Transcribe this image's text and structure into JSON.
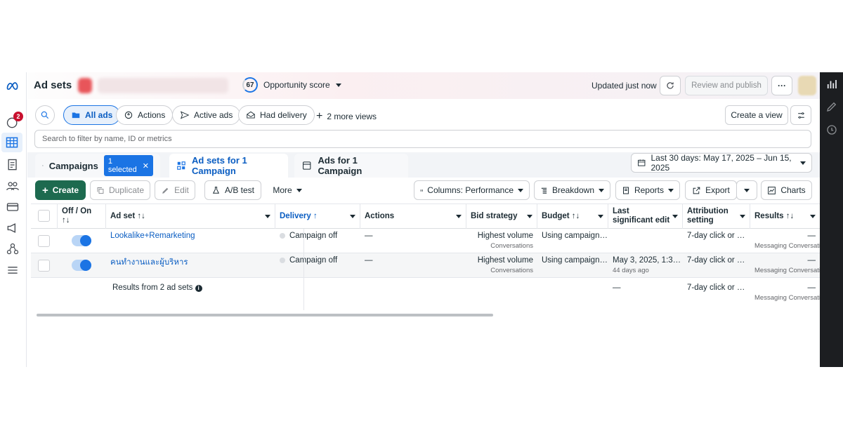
{
  "nav": {
    "notifications_count": "2",
    "items": [
      "meta-logo-icon",
      "notifications-icon",
      "campaigns-table-icon",
      "pages-icon",
      "audiences-icon",
      "billing-icon",
      "ads-manager-icon",
      "business-icon",
      "menu-icon"
    ]
  },
  "header": {
    "title": "Ad sets",
    "opportunity_score": "67",
    "opportunity_label": "Opportunity score",
    "updated": "Updated just now",
    "review_publish": "Review and publish",
    "more": "···"
  },
  "views": {
    "all_ads": "All ads",
    "actions": "Actions",
    "active_ads": "Active ads",
    "had_delivery": "Had delivery",
    "more_views": "2 more views",
    "create_view": "Create a view"
  },
  "search": {
    "placeholder": "Search to filter by name, ID or metrics"
  },
  "tabs": {
    "campaigns": "Campaigns",
    "selected": "1 selected",
    "adsets": "Ad sets for 1 Campaign",
    "ads": "Ads for 1 Campaign"
  },
  "date_range": "Last 30 days: May 17, 2025 – Jun 15, 2025",
  "toolbar": {
    "create": "Create",
    "duplicate": "Duplicate",
    "edit": "Edit",
    "ab_test": "A/B test",
    "more": "More",
    "columns": "Columns: Performance",
    "breakdown": "Breakdown",
    "reports": "Reports",
    "export": "Export",
    "charts": "Charts"
  },
  "table": {
    "headers": {
      "offon": "Off / On",
      "offon_sort": "↑↓",
      "adset": "Ad set ↑↓",
      "delivery": "Delivery ↑",
      "actions": "Actions",
      "bid": "Bid strategy",
      "budget": "Budget ↑↓",
      "last_edit": "Last significant edit",
      "attribution": "Attribution setting",
      "results": "Results ↑↓"
    },
    "rows": [
      {
        "name": "Lookalike+Remarketing",
        "delivery": "Campaign off",
        "actions": "—",
        "bid": "Highest volume",
        "bid_sub": "Conversations",
        "budget": "Using campaign…",
        "last_edit": "",
        "last_edit_sub": "",
        "attribution": "7-day click or …",
        "results": "—",
        "results_sub": "Messaging Conversati"
      },
      {
        "name": "คนทำงานและผู้บริหาร",
        "delivery": "Campaign off",
        "actions": "—",
        "bid": "Highest volume",
        "bid_sub": "Conversations",
        "budget": "Using campaign…",
        "last_edit": "May 3, 2025, 1:3…",
        "last_edit_sub": "44 days ago",
        "attribution": "7-day click or …",
        "results": "—",
        "results_sub": "Messaging Conversati"
      }
    ],
    "summary": {
      "label": "Results from 2 ad sets",
      "info_icon": "info-icon",
      "last_edit": "—",
      "attribution": "7-day click or …",
      "results": "—",
      "results_sub": "Messaging Conversati"
    }
  },
  "colors": {
    "accent": "#1b74e4",
    "create": "#1d6a4f",
    "right_rail": "#1c1e21"
  }
}
